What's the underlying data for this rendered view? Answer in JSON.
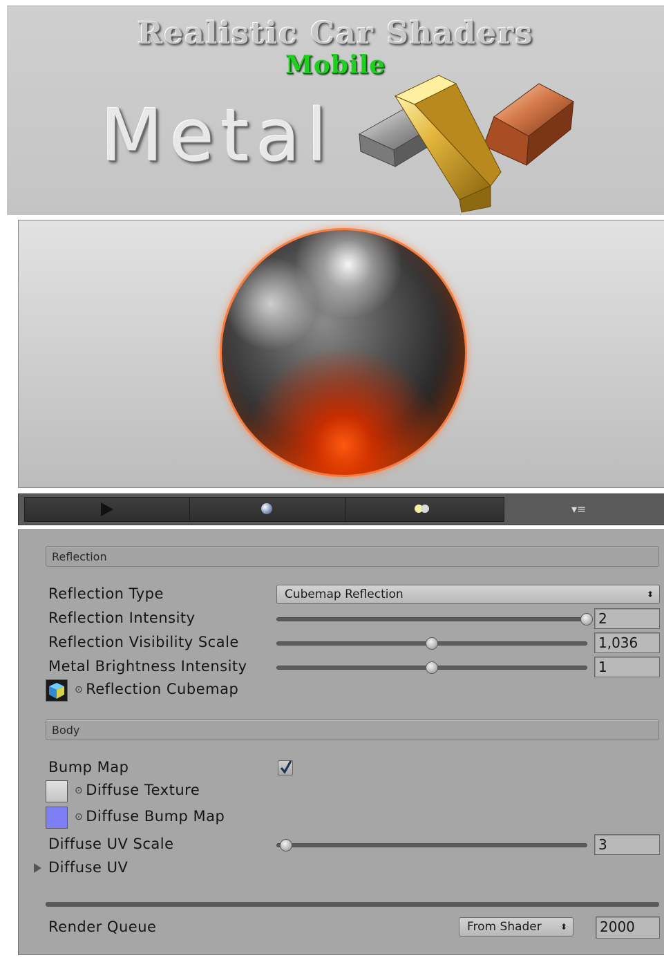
{
  "banner": {
    "title": "Realistic Car Shaders",
    "subtitle": "Mobile",
    "product": "Metal"
  },
  "preview_toolbar": {
    "icons": [
      "play-icon",
      "sphere-icon",
      "lights-icon",
      "menu-icon"
    ],
    "menu_glyph": "▾≡"
  },
  "reflection": {
    "header": "Reflection",
    "type_label": "Reflection Type",
    "type_value": "Cubemap Reflection",
    "intensity_label": "Reflection Intensity",
    "intensity_value": "2",
    "intensity_fraction": 1.0,
    "visibility_label": "Reflection Visibility Scale",
    "visibility_value": "1,036",
    "visibility_fraction": 0.5,
    "brightness_label": "Metal Brightness Intensity",
    "brightness_value": "1",
    "brightness_fraction": 0.5,
    "cubemap_label": "Reflection Cubemap"
  },
  "body": {
    "header": "Body",
    "bump_label": "Bump Map",
    "bump_checked": true,
    "diffuse_texture_label": "Diffuse Texture",
    "diffuse_bump_label": "Diffuse Bump Map",
    "uv_scale_label": "Diffuse UV Scale",
    "uv_scale_value": "3",
    "uv_scale_fraction": 0.03,
    "uv_foldout_label": "Diffuse UV"
  },
  "render_queue": {
    "label": "Render Queue",
    "mode": "From Shader",
    "value": "2000"
  },
  "colors": {
    "inspector_bg": "#a6a6a6",
    "bump_swatch": "#7f7ff5",
    "texture_swatch": "#d8d8d8"
  }
}
